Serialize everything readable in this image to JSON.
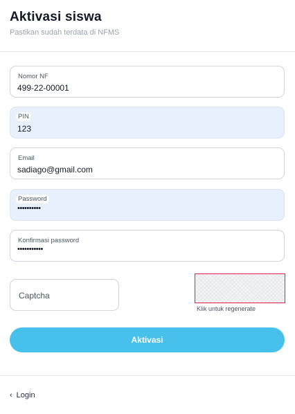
{
  "header": {
    "title": "Aktivasi siswa",
    "subtitle": "Pastikan sudah terdata di NFMS"
  },
  "form": {
    "nomor_nf": {
      "label": "Nomor NF",
      "value": "499-22-00001"
    },
    "pin": {
      "label": "PIN",
      "value": "123"
    },
    "email": {
      "label": "Email",
      "value": "sadiago@gmail.com"
    },
    "password": {
      "label": "Password",
      "value": "••••••••••"
    },
    "konfirmasi": {
      "label": "Konfirmasi password",
      "value": "•••••••••••"
    },
    "captcha": {
      "placeholder": "Captcha",
      "value": ""
    },
    "regenerate_text": "Klik untuk regenerate",
    "submit_label": "Aktivasi"
  },
  "footer": {
    "back_label": "Login",
    "back_icon": "chevron-left-icon"
  },
  "colors": {
    "accent": "#47c1ec",
    "autofill_bg": "#e8f0fe",
    "captcha_border": "#e11d48"
  }
}
